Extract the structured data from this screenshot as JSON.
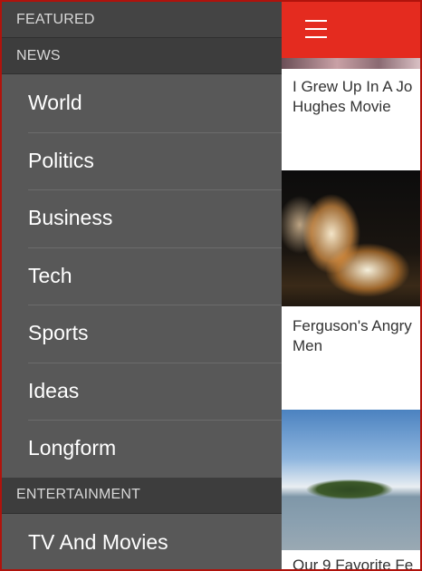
{
  "drawer": {
    "sections": [
      {
        "header": "FEATURED",
        "items": []
      },
      {
        "header": "NEWS",
        "items": [
          "World",
          "Politics",
          "Business",
          "Tech",
          "Sports",
          "Ideas",
          "Longform"
        ]
      },
      {
        "header": "ENTERTAINMENT",
        "items": [
          "TV And Movies"
        ]
      }
    ]
  },
  "content": {
    "menu_icon": "hamburger-menu-icon",
    "accent_color": "#e42b1f",
    "cards": [
      {
        "title_line1": "I Grew Up In A Jo",
        "title_line2": "Hughes Movie"
      },
      {
        "title_line1": "Ferguson's Angry",
        "title_line2": "Men"
      },
      {
        "title_line1": "Our 9 Favorite Fe",
        "title_line2": ""
      }
    ]
  }
}
